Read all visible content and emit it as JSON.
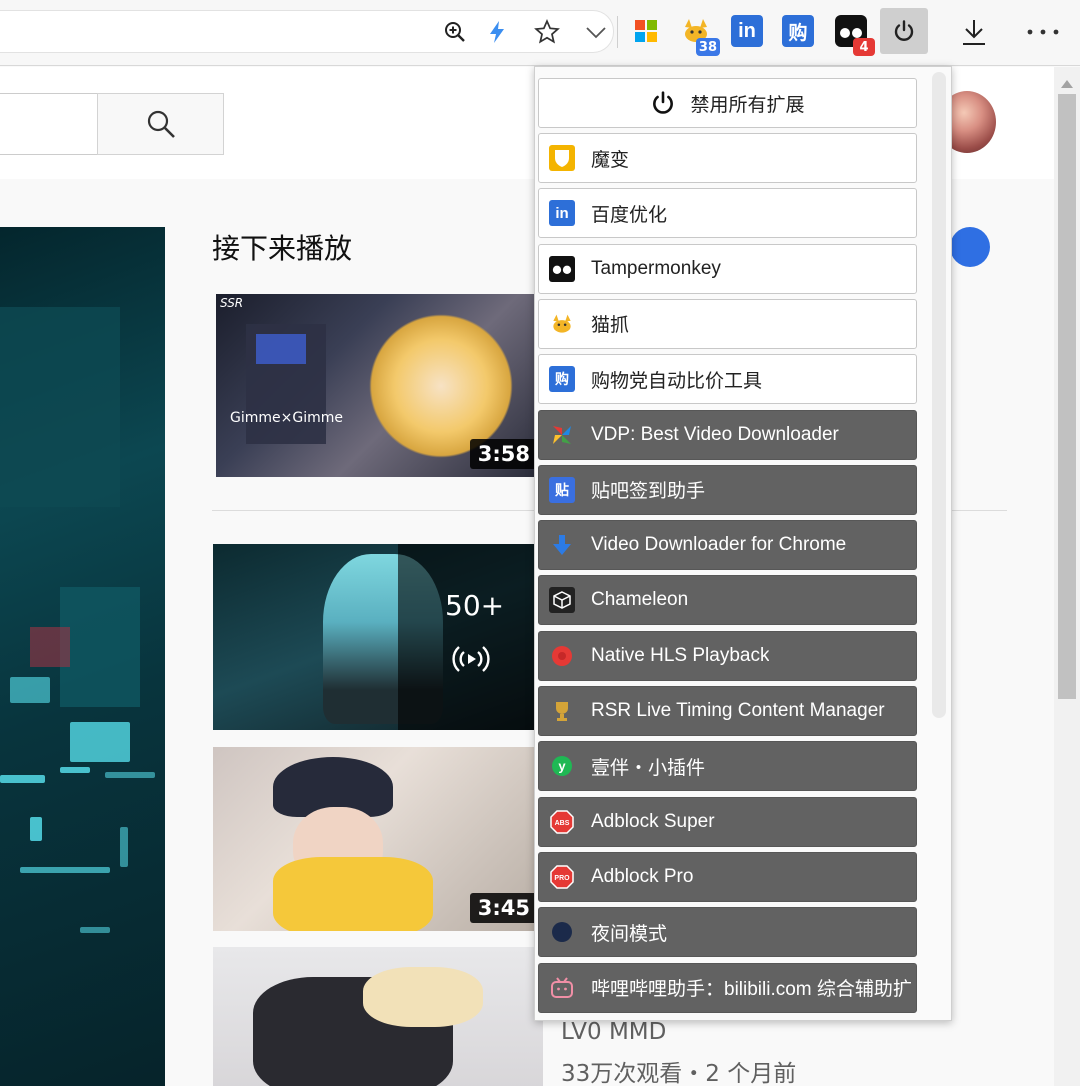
{
  "toolbar": {
    "ext_badges": {
      "cat": "38",
      "tamper": "4"
    },
    "icons": [
      "zoom-icon",
      "bolt-icon",
      "star-icon",
      "chevron-down-icon",
      "windows-icon",
      "cat-icon",
      "linkedin-icon",
      "shopping-icon",
      "tampermonkey-icon",
      "power-icon",
      "download-icon",
      "more-icon"
    ]
  },
  "masthead": {
    "search_icon": "search-icon"
  },
  "upnext": {
    "title": "接下来播放",
    "videos": [
      {
        "duration": "3:58",
        "corner": "SSR",
        "overlay": "Gimme×Gimme"
      },
      {
        "playlist_count": "50+"
      },
      {
        "duration": "3:45"
      },
      {
        "channel": "LV0 MMD",
        "stats": "33万次观看・2 个月前"
      }
    ]
  },
  "popup": {
    "disable_all": "禁用所有扩展",
    "extensions": [
      {
        "name": "魔变",
        "enabled": true,
        "icon": "shield-icon",
        "color": "#f4b400"
      },
      {
        "name": "百度优化",
        "enabled": true,
        "icon": "linkedin-icon",
        "color": "#2d6fd8"
      },
      {
        "name": "Tampermonkey",
        "enabled": true,
        "icon": "tampermonkey-icon",
        "color": "#111111"
      },
      {
        "name": "猫抓",
        "enabled": true,
        "icon": "cat-icon",
        "color": "#f2b928"
      },
      {
        "name": "购物党自动比价工具",
        "enabled": true,
        "icon": "shopping-icon",
        "color": "#2d6fd8"
      },
      {
        "name": "VDP: Best Video Downloader",
        "enabled": false,
        "icon": "pinwheel-icon",
        "color": "#4caf50"
      },
      {
        "name": "贴吧签到助手",
        "enabled": false,
        "icon": "tieba-icon",
        "color": "#3a6fe0"
      },
      {
        "name": "Video Downloader for Chrome",
        "enabled": false,
        "icon": "down-arrow-icon",
        "color": "#2c7be5"
      },
      {
        "name": "Chameleon",
        "enabled": false,
        "icon": "cube-icon",
        "color": "#222222"
      },
      {
        "name": "Native HLS Playback",
        "enabled": false,
        "icon": "record-icon",
        "color": "#e53935"
      },
      {
        "name": "RSR Live Timing Content Manager",
        "enabled": false,
        "icon": "trophy-icon",
        "color": "#c99a2e"
      },
      {
        "name": "壹伴・小插件",
        "enabled": false,
        "icon": "yiban-icon",
        "color": "#1fb854"
      },
      {
        "name": "Adblock Super",
        "enabled": false,
        "icon": "abs-stop-icon",
        "color": "#e53935"
      },
      {
        "name": "Adblock Pro",
        "enabled": false,
        "icon": "pro-stop-icon",
        "color": "#e53935"
      },
      {
        "name": "夜间模式",
        "enabled": false,
        "icon": "moon-icon",
        "color": "#1b2a4a"
      },
      {
        "name": "哔哩哔哩助手：bilibili.com 综合辅助扩展",
        "enabled": false,
        "icon": "bilibili-icon",
        "color": "#f08fa6"
      }
    ]
  }
}
